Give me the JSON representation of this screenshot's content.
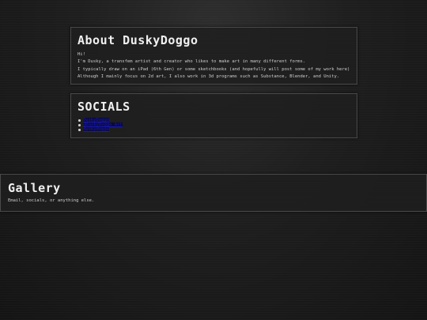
{
  "about": {
    "title": "About DuskyDoggo",
    "lines": [
      "Hi!",
      "I'm Dusky, a transfem artist and creator who likes to make art in many different forms.",
      "I typically draw on an iPad (6th Gen) or some sketchbooks (and hopefully will post some of my work here)",
      "Although I mainly focus on 2d art, I also work in 3d programs such as Substance, Blender, and Unity."
    ]
  },
  "socials": {
    "title": "SOCIALS",
    "links": [
      "DuskyDoggo",
      "@DuskyDoggo_Art",
      "duskydoggo"
    ]
  },
  "gallery": {
    "title": "Gallery",
    "subtitle": "Email, socials, or anything else."
  },
  "colors": {
    "link": "#1a1ab8",
    "panel_border": "#4a4a4a",
    "background": "#1e1e1e"
  }
}
